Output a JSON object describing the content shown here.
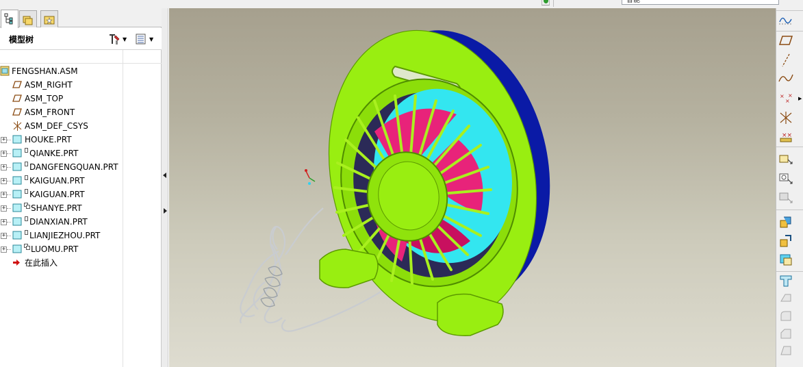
{
  "topbar": {
    "field_text": "智能"
  },
  "left_panel": {
    "tabs": [
      {
        "icon": "model-tree-icon",
        "active": true
      },
      {
        "icon": "folder-browser-icon",
        "active": false
      },
      {
        "icon": "favorites-icon",
        "active": false
      }
    ],
    "title": "模型树",
    "settings_icon": "tree-settings-icon",
    "show_icon": "tree-show-icon"
  },
  "model_tree": {
    "root": {
      "label": "FENGSHAN.ASM",
      "icon": "assembly-icon"
    },
    "items": [
      {
        "label": "ASM_RIGHT",
        "icon": "datum-plane-icon",
        "expandable": false,
        "marker": ""
      },
      {
        "label": "ASM_TOP",
        "icon": "datum-plane-icon",
        "expandable": false,
        "marker": ""
      },
      {
        "label": "ASM_FRONT",
        "icon": "datum-plane-icon",
        "expandable": false,
        "marker": ""
      },
      {
        "label": "ASM_DEF_CSYS",
        "icon": "coordinate-system-icon",
        "expandable": false,
        "marker": ""
      },
      {
        "label": "HOUKE.PRT",
        "icon": "part-icon",
        "expandable": true,
        "marker": ""
      },
      {
        "label": "QIANKE.PRT",
        "icon": "part-icon",
        "expandable": true,
        "marker": "box"
      },
      {
        "label": "DANGFENGQUAN.PRT",
        "icon": "part-icon",
        "expandable": true,
        "marker": "box"
      },
      {
        "label": "KAIGUAN.PRT",
        "icon": "part-icon",
        "expandable": true,
        "marker": "box"
      },
      {
        "label": "KAIGUAN.PRT",
        "icon": "part-icon",
        "expandable": true,
        "marker": "box"
      },
      {
        "label": "SHANYE.PRT",
        "icon": "part-icon",
        "expandable": true,
        "marker": "double"
      },
      {
        "label": "DIANXIAN.PRT",
        "icon": "part-icon",
        "expandable": true,
        "marker": "box"
      },
      {
        "label": "LIANJIEZHOU.PRT",
        "icon": "part-icon",
        "expandable": true,
        "marker": "box"
      },
      {
        "label": "LUOMU.PRT",
        "icon": "part-icon",
        "expandable": true,
        "marker": "double"
      }
    ],
    "insert_here": {
      "label": "在此插入",
      "icon": "insert-arrow-icon"
    }
  },
  "viewport": {
    "model": "desk-fan-assembly",
    "colors": {
      "body": "#99ee11",
      "rear_ring": "#0a1aa6",
      "blade_magenta": "#e8237a",
      "blade_cyan": "#33e6f0",
      "cable": "#c9ccd0"
    }
  },
  "right_toolbar": {
    "tools": [
      "sketch-icon",
      "datum-plane-tool-icon",
      "datum-axis-icon",
      "datum-curve-icon",
      "datum-point-icon",
      "csys-tool-icon",
      "analysis-icon",
      "place-component-icon",
      "create-component-icon",
      "package-component-icon",
      "extrude-icon",
      "revolve-icon",
      "sweep-icon",
      "cut-icon",
      "hole-icon",
      "round-icon",
      "chamfer-icon"
    ]
  }
}
